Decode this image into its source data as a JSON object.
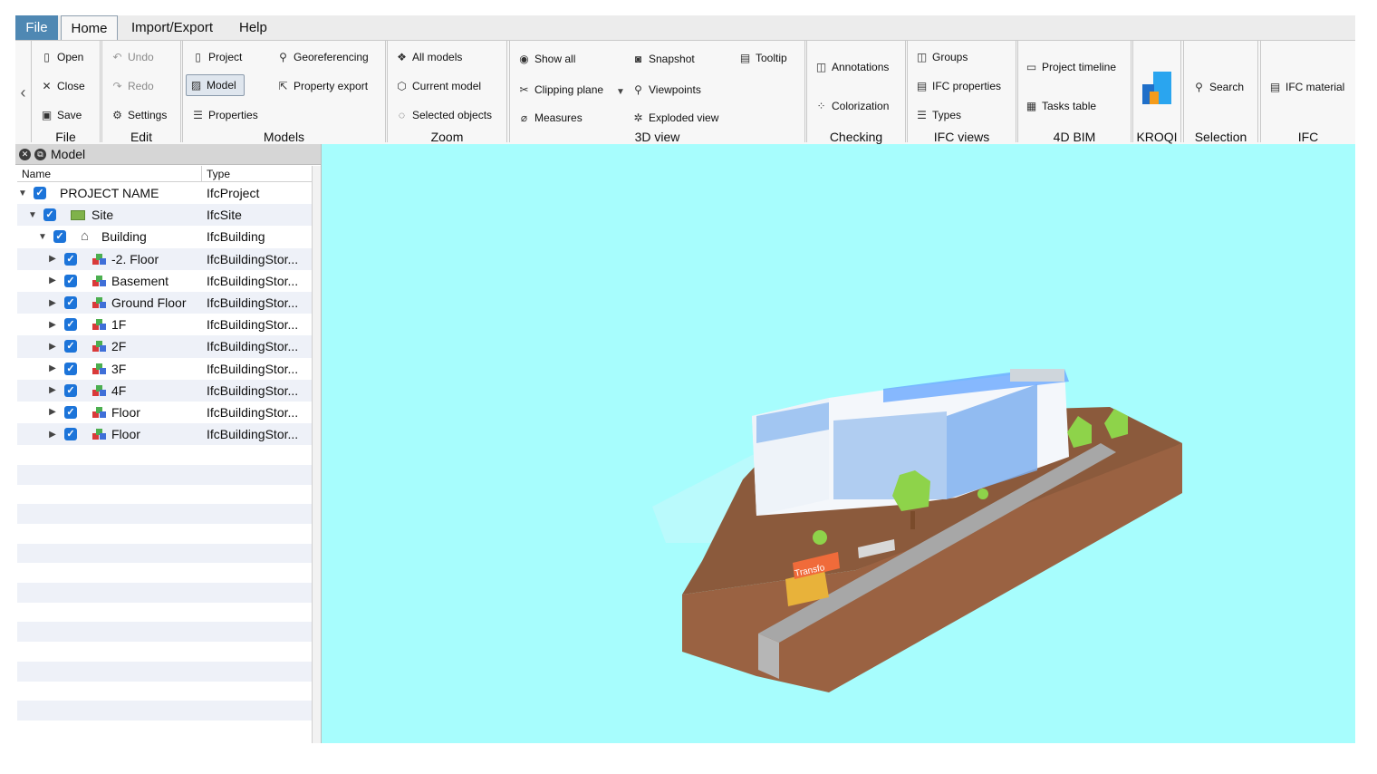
{
  "menu": {
    "file": "File",
    "home": "Home",
    "import_export": "Import/Export",
    "help": "Help"
  },
  "ribbon": {
    "file": {
      "label": "File",
      "open": "Open",
      "close": "Close",
      "save": "Save"
    },
    "edit": {
      "label": "Edit",
      "undo": "Undo",
      "redo": "Redo",
      "settings": "Settings"
    },
    "models": {
      "label": "Models",
      "project": "Project",
      "model": "Model",
      "properties": "Properties",
      "georeferencing": "Georeferencing",
      "property_export": "Property export"
    },
    "zoom": {
      "label": "Zoom",
      "all_models": "All models",
      "current_model": "Current model",
      "selected_objects": "Selected objects"
    },
    "view3d": {
      "label": "3D view",
      "show_all": "Show all",
      "clipping_plane": "Clipping plane",
      "measures": "Measures",
      "snapshot": "Snapshot",
      "viewpoints": "Viewpoints",
      "exploded_view": "Exploded view",
      "tooltip": "Tooltip"
    },
    "checking": {
      "label": "Checking",
      "annotations": "Annotations",
      "colorization": "Colorization"
    },
    "ifc_views": {
      "label": "IFC views",
      "groups": "Groups",
      "ifc_properties": "IFC properties",
      "types": "Types"
    },
    "bim4d": {
      "label": "4D BIM",
      "project_timeline": "Project timeline",
      "tasks_table": "Tasks table"
    },
    "kroqi": {
      "label": "KROQI"
    },
    "selection": {
      "label": "Selection",
      "search": "Search"
    },
    "ifc": {
      "label": "IFC",
      "ifc_material": "IFC material"
    }
  },
  "panel": {
    "title": "Model",
    "col_name": "Name",
    "col_type": "Type",
    "tree": [
      {
        "name": "PROJECT NAME",
        "type": "IfcProject"
      },
      {
        "name": "Site",
        "type": "IfcSite"
      },
      {
        "name": "Building",
        "type": "IfcBuilding"
      },
      {
        "name": "-2. Floor",
        "type": "IfcBuildingStor..."
      },
      {
        "name": "Basement",
        "type": "IfcBuildingStor..."
      },
      {
        "name": "Ground Floor",
        "type": "IfcBuildingStor..."
      },
      {
        "name": "1F",
        "type": "IfcBuildingStor..."
      },
      {
        "name": "2F",
        "type": "IfcBuildingStor..."
      },
      {
        "name": "3F",
        "type": "IfcBuildingStor..."
      },
      {
        "name": "4F",
        "type": "IfcBuildingStor..."
      },
      {
        "name": "Floor",
        "type": "IfcBuildingStor..."
      },
      {
        "name": "Floor",
        "type": "IfcBuildingStor..."
      }
    ]
  },
  "viewport": {
    "sign_text": "Transfo"
  },
  "colors": {
    "accent": "#4f88b3",
    "checkbox": "#1c74d9",
    "viewport_bg": "#a7fdfd",
    "terrain": "#8b5a3c"
  }
}
